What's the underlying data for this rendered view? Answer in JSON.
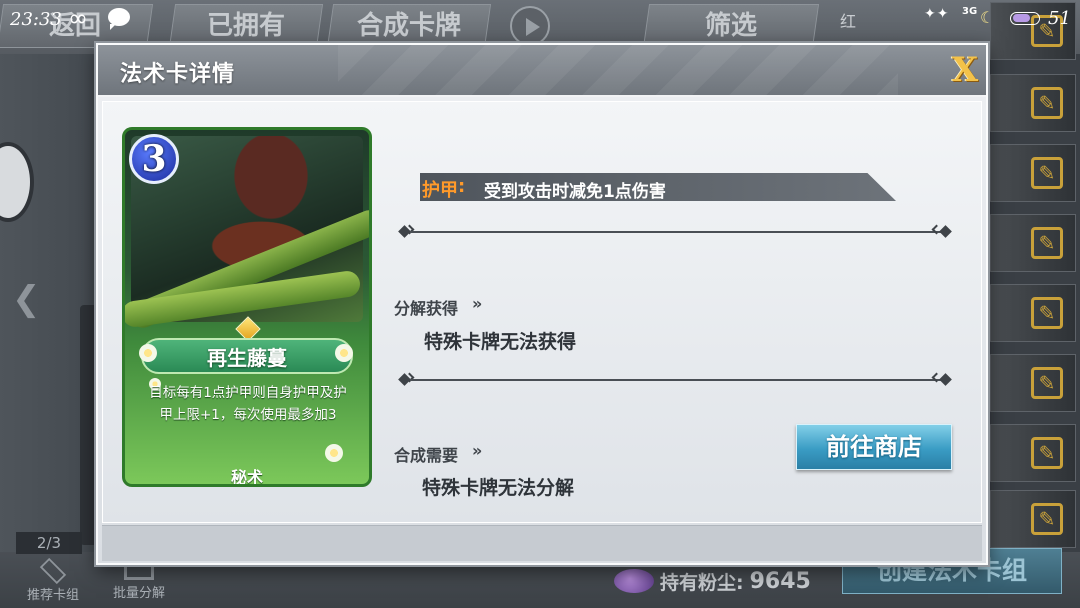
{
  "status_bar": {
    "time": "23:33",
    "network": "3G",
    "level": "51"
  },
  "background": {
    "tabs": {
      "back": "返回",
      "owned": "已拥有",
      "compose": "合成卡牌",
      "filter": "筛选"
    },
    "red_label": "红",
    "pager": "2/3",
    "recommend_deck": "推荐卡组",
    "batch_decompose": "批量分解",
    "dust_label": "持有粉尘:",
    "dust_value": "9645",
    "create_deck": "创建法术卡组"
  },
  "modal": {
    "title": "法术卡详情",
    "close_label": "X"
  },
  "card": {
    "cost": "3",
    "name": "再生藤蔓",
    "description": "目标每有1点护甲则自身护甲及护甲上限+1，每次使用最多加3",
    "type": "秘术"
  },
  "details": {
    "keyword_name": "护甲",
    "keyword_colon": ":",
    "keyword_effect": "受到攻击时减免1点伤害",
    "decompose_label": "分解获得",
    "decompose_value": "特殊卡牌无法获得",
    "synthesis_label": "合成需要",
    "synthesis_value": "特殊卡牌无法分解",
    "shop_button": "前往商店"
  },
  "icons": {
    "close": "close-icon",
    "arrow": "double-chevron-right-icon",
    "edit": "edit-icon",
    "dust": "dust-gem-icon"
  },
  "colors": {
    "keyword_accent": "#ff9a2a",
    "shop_button": "#3a9cc4",
    "card_border": "#2f7a2a",
    "cost_orb": "#1a2a9a"
  }
}
